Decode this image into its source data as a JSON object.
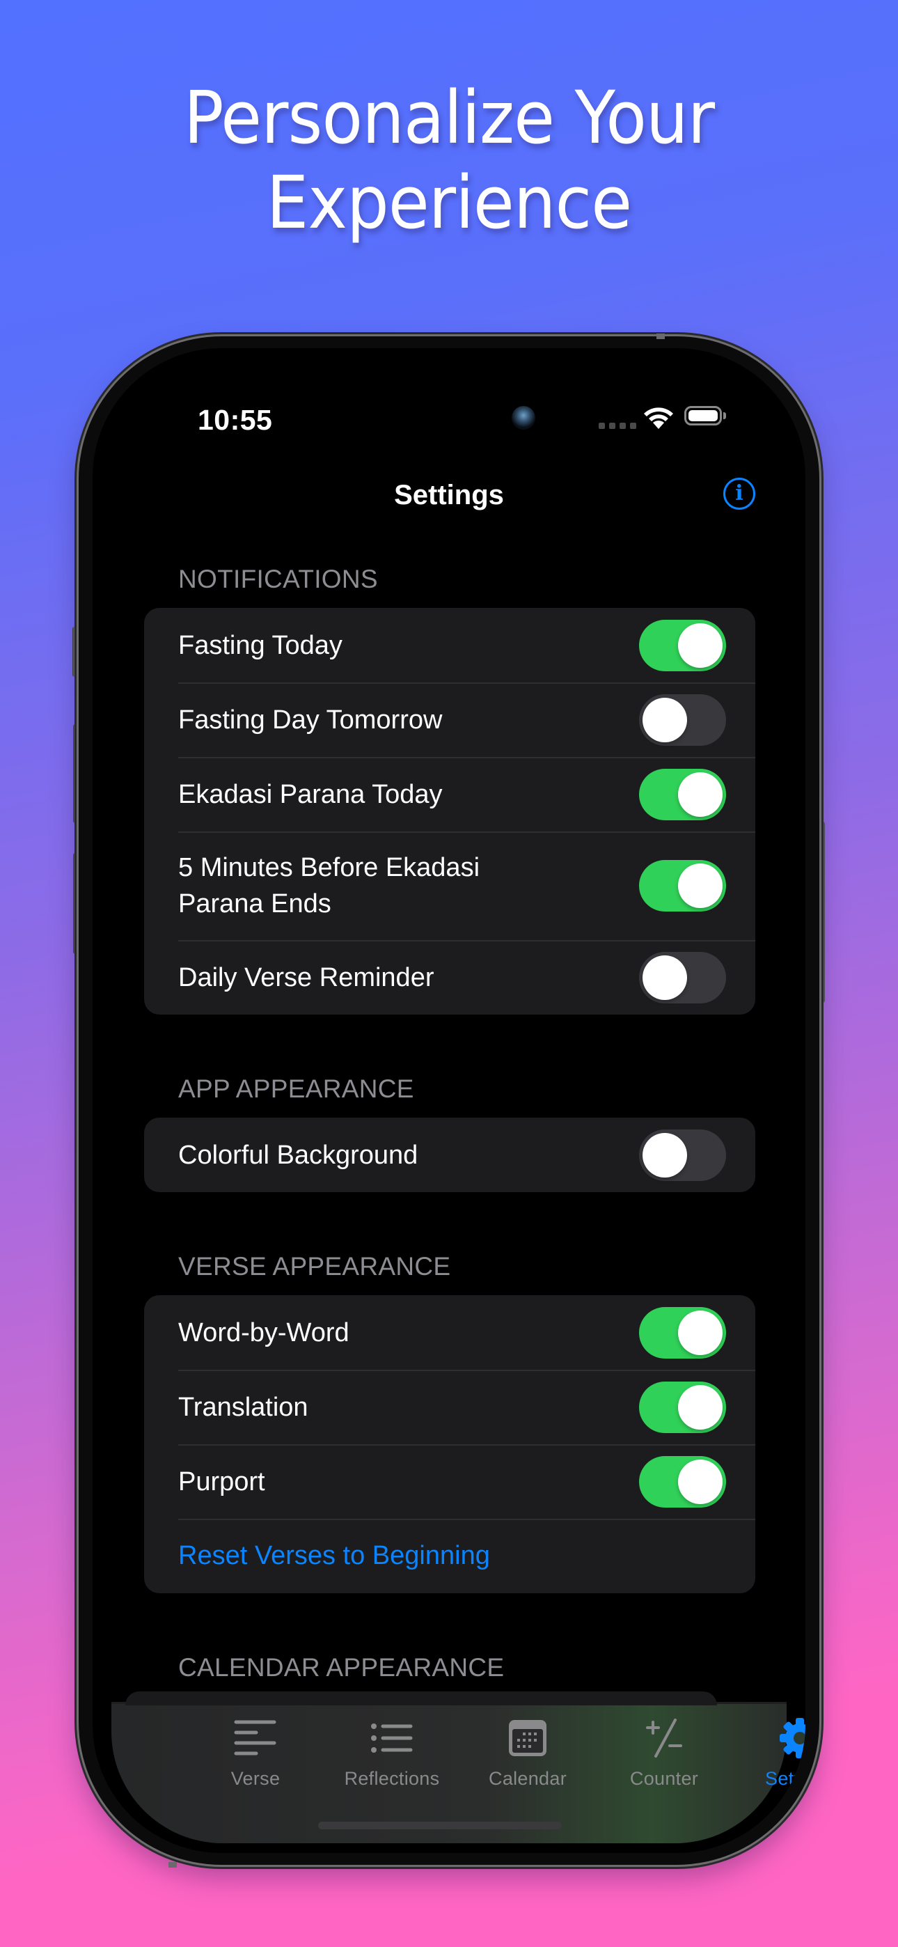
{
  "headline": {
    "line1": "Personalize Your",
    "line2": "Experience"
  },
  "colors": {
    "background_top": "#5271FF",
    "background_bottom": "#FF66C4",
    "accent": "#0A84FF",
    "toggle_on": "#30D158",
    "toggle_off": "#39393D",
    "card": "#1C1C1E",
    "section_header": "#8D8D93"
  },
  "status_bar": {
    "time": "10:55",
    "wifi_icon": "wifi-icon",
    "battery_icon": "battery-icon",
    "signal_icon": "no-signal-icon"
  },
  "nav": {
    "title": "Settings",
    "info_icon": "info-circle-icon",
    "info_glyph": "i"
  },
  "sections": [
    {
      "header": "NOTIFICATIONS",
      "rows": [
        {
          "label": "Fasting Today",
          "on": true
        },
        {
          "label": "Fasting Day Tomorrow",
          "on": false
        },
        {
          "label": "Ekadasi Parana Today",
          "on": true
        },
        {
          "label": "5 Minutes Before Ekadasi Parana Ends",
          "on": true
        },
        {
          "label": "Daily Verse Reminder",
          "on": false
        }
      ]
    },
    {
      "header": "APP APPEARANCE",
      "rows": [
        {
          "label": "Colorful Background",
          "on": false
        }
      ]
    },
    {
      "header": "VERSE APPEARANCE",
      "rows": [
        {
          "label": "Word-by-Word",
          "on": true
        },
        {
          "label": "Translation",
          "on": true
        },
        {
          "label": "Purport",
          "on": true
        }
      ],
      "link": "Reset Verses to Beginning"
    },
    {
      "header": "CALENDAR APPEARANCE",
      "rows": []
    }
  ],
  "tabs": [
    {
      "label": "Verse",
      "icon": "text-align-left-icon",
      "active": false
    },
    {
      "label": "Reflections",
      "icon": "list-bullet-icon",
      "active": false
    },
    {
      "label": "Calendar",
      "icon": "calendar-icon",
      "active": false
    },
    {
      "label": "Counter",
      "icon": "plus-minus-icon",
      "active": false
    },
    {
      "label": "Settings",
      "icon": "gear-icon",
      "active": true
    }
  ]
}
